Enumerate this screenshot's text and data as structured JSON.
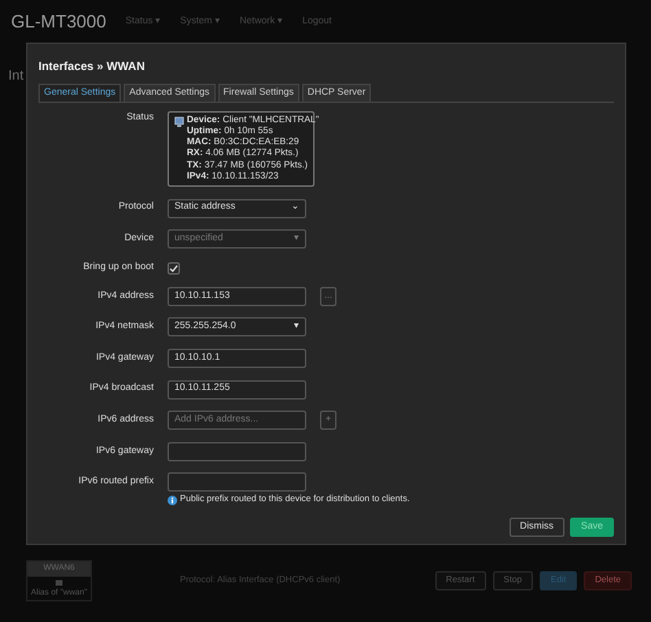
{
  "navbar": {
    "brand": "GL-MT3000",
    "menu": [
      {
        "label": "Status",
        "caret": "▾"
      },
      {
        "label": "System",
        "caret": "▾"
      },
      {
        "label": "Network",
        "caret": "▾"
      }
    ],
    "logout": "Logout"
  },
  "page_heading": "Int",
  "modal": {
    "title": "Interfaces » WWAN",
    "tabs": [
      {
        "label": "General Settings",
        "selected": true
      },
      {
        "label": "Advanced Settings",
        "selected": false
      },
      {
        "label": "Firewall Settings",
        "selected": false
      },
      {
        "label": "DHCP Server",
        "selected": false
      }
    ],
    "status": {
      "label": "Status",
      "lines": [
        {
          "key": "Device:",
          "value": "Client \"MLHCENTRAL\""
        },
        {
          "key": "Uptime:",
          "value": "0h 10m 55s"
        },
        {
          "key": "MAC:",
          "value": "B0:3C:DC:EA:EB:29"
        },
        {
          "key": "RX:",
          "value": "4.06 MB (12774 Pkts.)"
        },
        {
          "key": "TX:",
          "value": "37.47 MB (160756 Pkts.)"
        },
        {
          "key": "IPv4:",
          "value": "10.10.11.153/23"
        }
      ]
    },
    "fields": [
      {
        "kind": "select",
        "label": "Protocol",
        "value": "Static address",
        "disabled": false,
        "caret": "⌄"
      },
      {
        "kind": "select",
        "label": "Device",
        "value": "unspecified",
        "disabled": true,
        "caret": "▾"
      },
      {
        "kind": "checkbox",
        "label": "Bring up on boot",
        "checked": true
      },
      {
        "kind": "text",
        "label": "IPv4 address",
        "value": "10.10.11.153",
        "addon": "..."
      },
      {
        "kind": "select",
        "label": "IPv4 netmask",
        "value": "255.255.254.0",
        "disabled": false,
        "caret": "▾"
      },
      {
        "kind": "text",
        "label": "IPv4 gateway",
        "value": "10.10.10.1"
      },
      {
        "kind": "text",
        "label": "IPv4 broadcast",
        "value": "10.10.11.255"
      },
      {
        "kind": "text",
        "label": "IPv6 address",
        "placeholder": "Add IPv6 address...",
        "addon": "+"
      },
      {
        "kind": "text",
        "label": "IPv6 gateway"
      },
      {
        "kind": "text",
        "label": "IPv6 routed prefix",
        "hint": "Public prefix routed to this device for distribution to clients."
      }
    ],
    "buttons": [
      {
        "label": "Dismiss",
        "kind": "dismiss"
      },
      {
        "label": "Save",
        "kind": "save"
      }
    ]
  },
  "interface_row": {
    "name": "WWAN6",
    "note": "Alias of \"wwan\"",
    "protocol": "Protocol: Alias Interface (DHCPv6 client)",
    "buttons": [
      {
        "label": "Restart",
        "kind": "default"
      },
      {
        "label": "Stop",
        "kind": "default"
      },
      {
        "label": "Edit",
        "kind": "edit"
      },
      {
        "label": "Delete",
        "kind": "delete"
      }
    ]
  }
}
